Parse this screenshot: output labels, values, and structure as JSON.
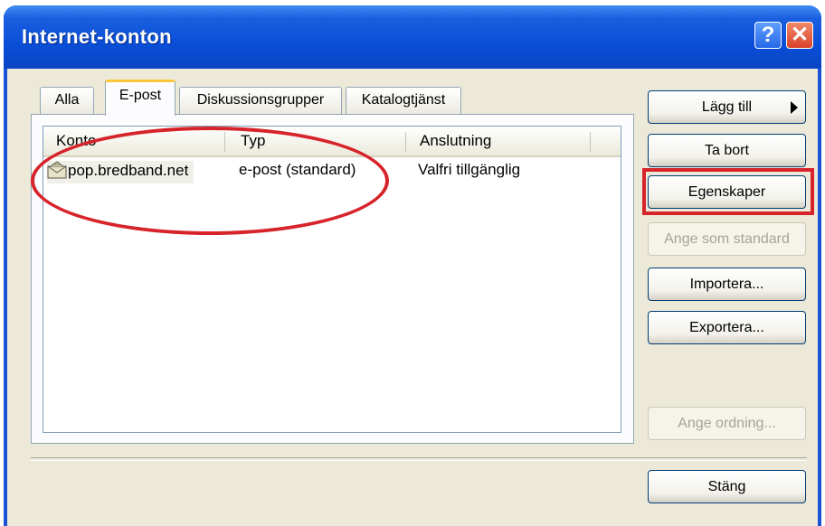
{
  "window": {
    "title": "Internet-konton"
  },
  "tabs": [
    {
      "label": "Alla"
    },
    {
      "label": "E-post"
    },
    {
      "label": "Diskussionsgrupper"
    },
    {
      "label": "Katalogtjänst"
    }
  ],
  "active_tab": "E-post",
  "list": {
    "columns": [
      "Konto",
      "Typ",
      "Anslutning"
    ],
    "rows": [
      {
        "konto": "pop.bredband.net",
        "typ": "e-post (standard)",
        "anslutning": "Valfri tillgänglig",
        "icon": "mail-account-icon"
      }
    ]
  },
  "buttons": {
    "add": "Lägg till",
    "remove": "Ta bort",
    "properties": "Egenskaper",
    "set_default": "Ange som standard",
    "import": "Importera...",
    "export": "Exportera...",
    "set_order": "Ange ordning...",
    "close": "Stäng"
  },
  "colors": {
    "annotation": "#d6242a",
    "titlebar": "#0a4fd8",
    "dialog_bg": "#ece9d8"
  }
}
